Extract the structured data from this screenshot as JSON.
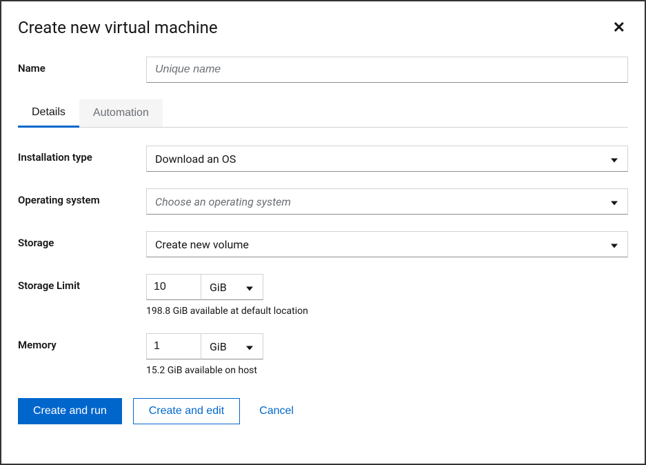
{
  "dialog": {
    "title": "Create new virtual machine"
  },
  "fields": {
    "name": {
      "label": "Name",
      "placeholder": "Unique name",
      "value": ""
    },
    "installationType": {
      "label": "Installation type",
      "value": "Download an OS"
    },
    "operatingSystem": {
      "label": "Operating system",
      "placeholder": "Choose an operating system"
    },
    "storage": {
      "label": "Storage",
      "value": "Create new volume"
    },
    "storageLimit": {
      "label": "Storage Limit",
      "value": "10",
      "unit": "GiB",
      "helper": "198.8 GiB available at default location"
    },
    "memory": {
      "label": "Memory",
      "value": "1",
      "unit": "GiB",
      "helper": "15.2 GiB available on host"
    }
  },
  "tabs": {
    "details": "Details",
    "automation": "Automation"
  },
  "buttons": {
    "createAndRun": "Create and run",
    "createAndEdit": "Create and edit",
    "cancel": "Cancel"
  }
}
